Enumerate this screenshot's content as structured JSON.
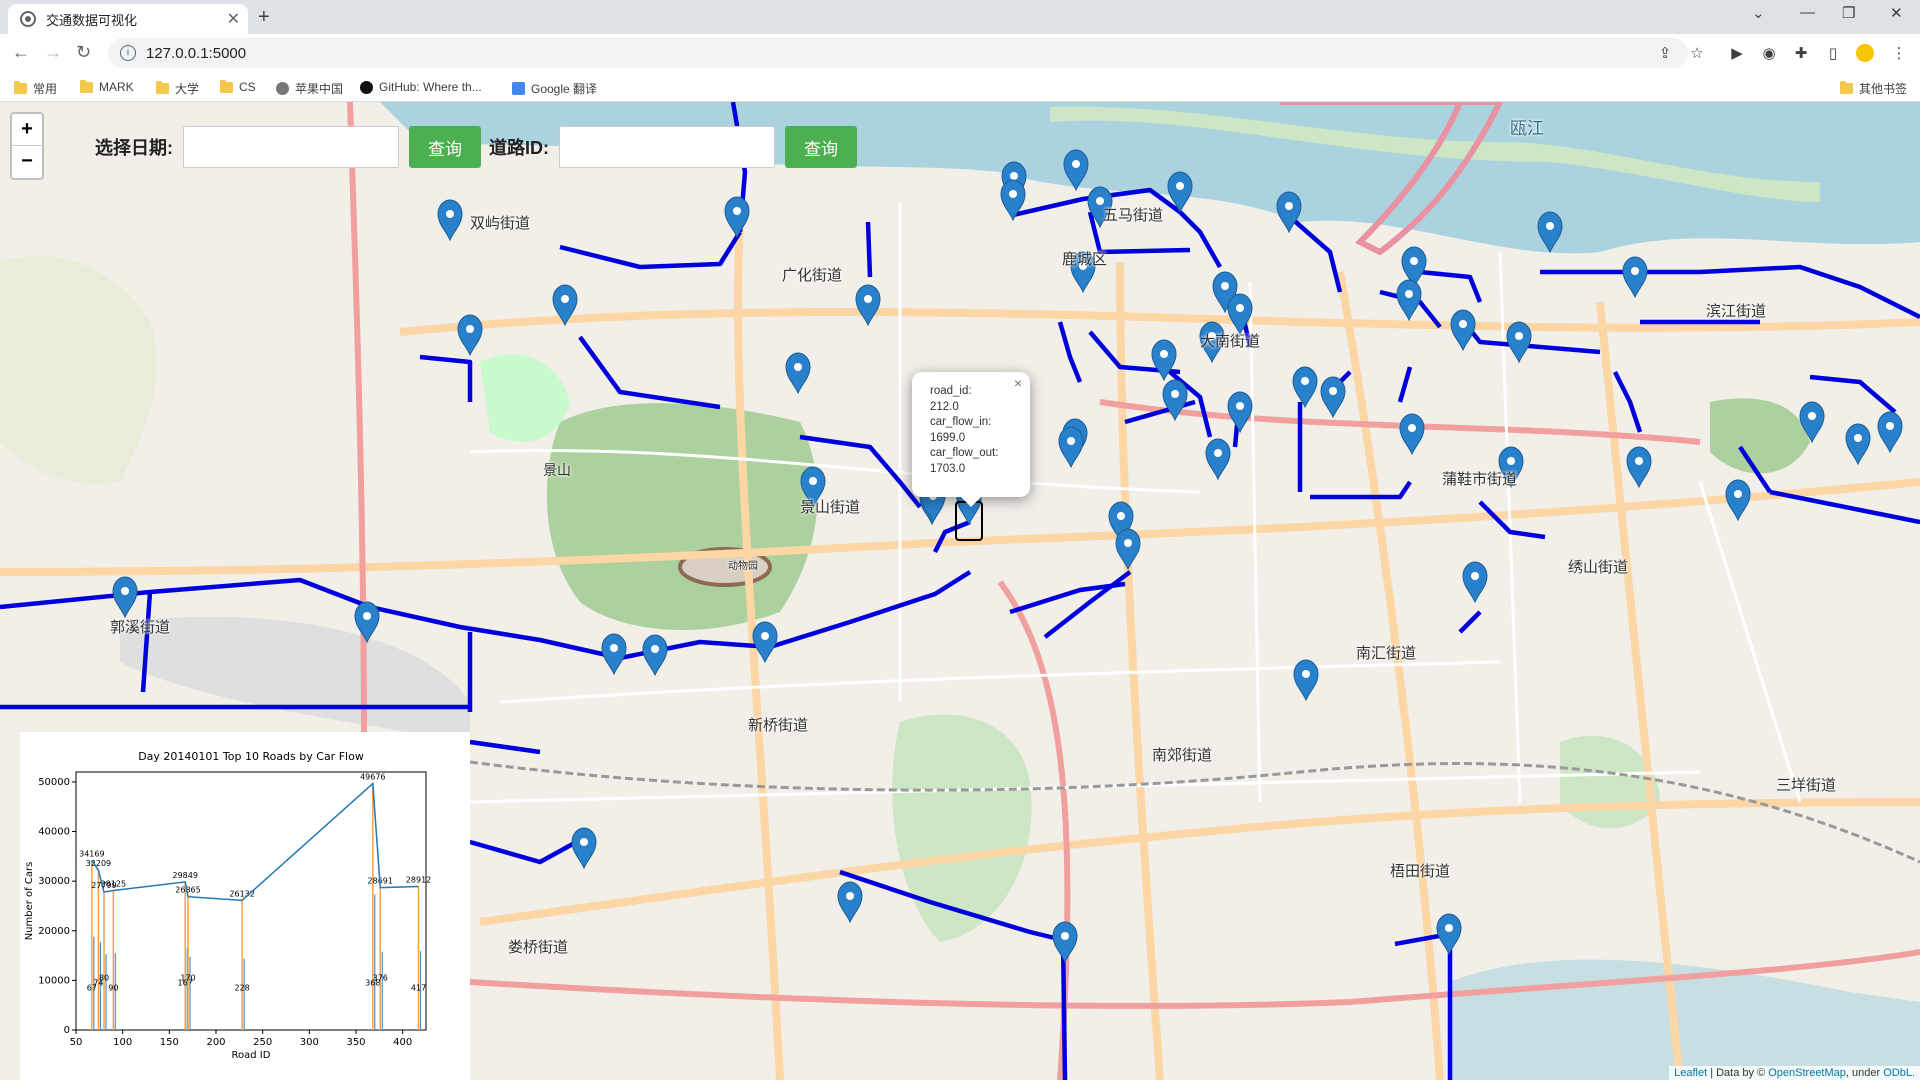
{
  "browser": {
    "tab_title": "交通数据可视化",
    "url": "127.0.0.1:5000",
    "bookmarks": [
      "常用",
      "MARK",
      "大学",
      "CS",
      "苹果中国",
      "GitHub: Where th...",
      "Google 翻译"
    ],
    "other_bookmarks": "其他书签"
  },
  "controls": {
    "date_label": "选择日期:",
    "query_button": "查询",
    "road_label": "道路ID:",
    "query_button2": "查询",
    "zoom_in": "+",
    "zoom_out": "−"
  },
  "popup": {
    "road_id_key": "road_id:",
    "road_id": "212.0",
    "flow_in_key": "car_flow_in:",
    "flow_in": "1699.0",
    "flow_out_key": "car_flow_out:",
    "flow_out": "1703.0",
    "close": "×"
  },
  "attribution": {
    "leaflet": "Leaflet",
    "data_by": "| Data by ©",
    "osm": "OpenStreetMap",
    "under": ", under",
    "odbl": "ODbL."
  },
  "places": [
    "瓯江",
    "双屿街道",
    "五马街道",
    "鹿城区",
    "广化街道",
    "大南街道",
    "滨江街道",
    "蒲鞋市街道",
    "景山街道",
    "绣山街道",
    "郭溪街道",
    "南汇街道",
    "新桥街道",
    "南郊街道",
    "三垟街道",
    "梧田街道",
    "娄桥街道",
    "动物园",
    "景山"
  ],
  "colors": {
    "route": "#0000dd",
    "marker": "#2a81cb",
    "button": "#4caf50",
    "water": "#aad3df"
  },
  "chart_data": {
    "type": "line",
    "title": "Day 20140101 Top 10 Roads by Car Flow",
    "xlabel": "Road ID",
    "ylabel": "Number of Cars",
    "xlim": [
      50,
      425
    ],
    "ylim": [
      0,
      52000
    ],
    "xticks": [
      50,
      100,
      150,
      200,
      250,
      300,
      350,
      400
    ],
    "yticks": [
      0,
      10000,
      20000,
      30000,
      40000,
      50000
    ],
    "series": [
      {
        "x": [
          67,
          74,
          80,
          90,
          167,
          170,
          228,
          368,
          376,
          417
        ],
        "values": [
          34169,
          32209,
          27799,
          28125,
          29849,
          26865,
          26132,
          49676,
          28691,
          28912
        ]
      }
    ],
    "bar_values": [
      67,
      74,
      80,
      90,
      167,
      170,
      228,
      368,
      376,
      417
    ],
    "labels": [
      "34169",
      "32209",
      "27799",
      "28125",
      "29849",
      "26865",
      "26132",
      "49676",
      "28691",
      "28912"
    ]
  }
}
